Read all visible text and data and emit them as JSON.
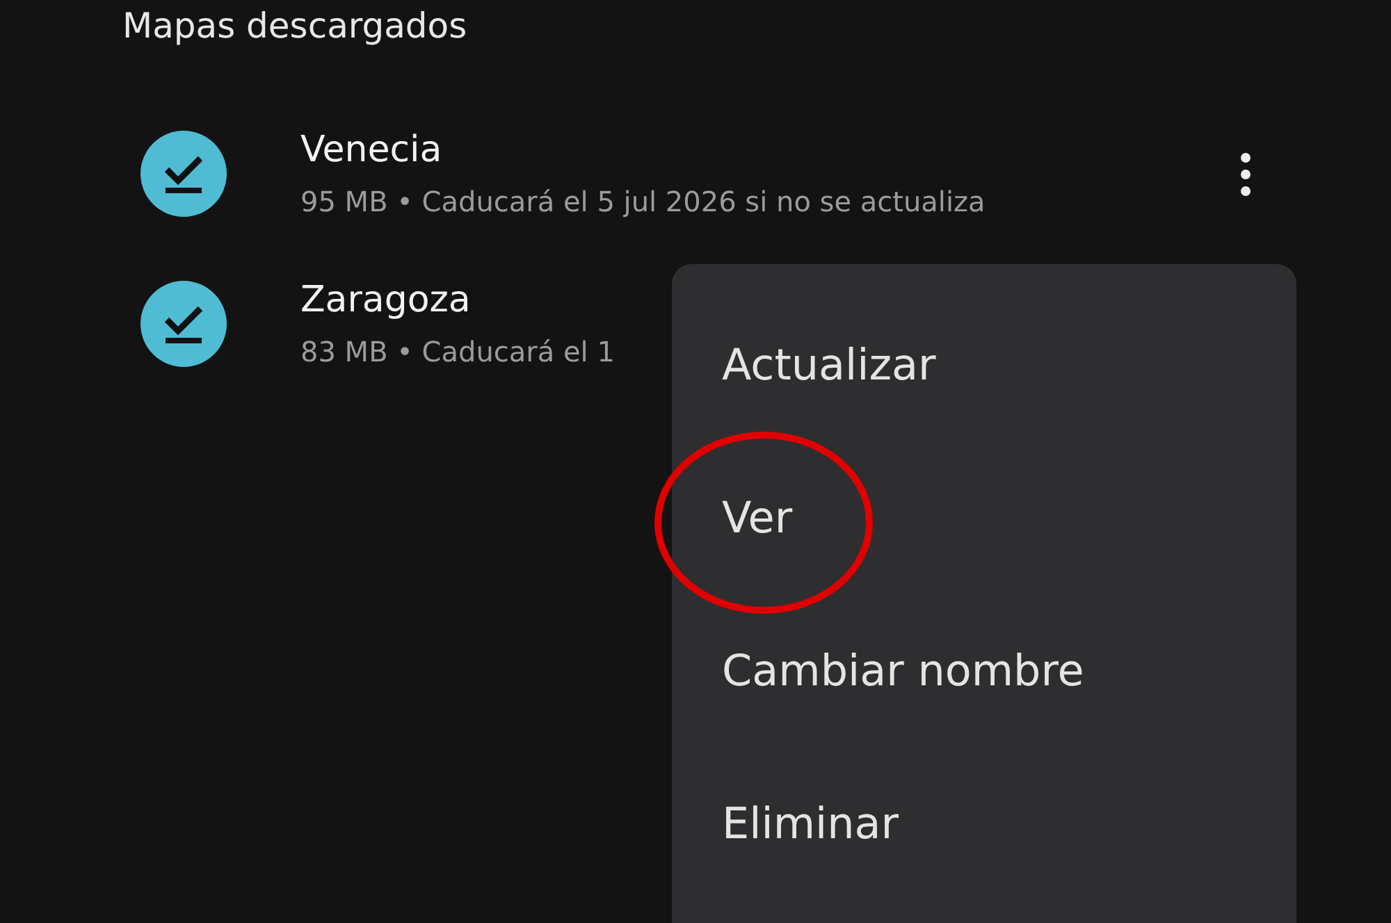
{
  "section_title": "Mapas descargados",
  "maps": [
    {
      "name": "Venecia",
      "details": "95 MB • Caducará el 5 jul 2026 si no se actualiza",
      "downloaded": true,
      "menu_button": true
    },
    {
      "name": "Zaragoza",
      "details": "83 MB • Caducará el 1",
      "downloaded": true,
      "menu_button": false
    }
  ],
  "menu": {
    "items": [
      {
        "label": "Actualizar",
        "highlighted": false
      },
      {
        "label": "Ver",
        "highlighted": true
      },
      {
        "label": "Cambiar nombre",
        "highlighted": false
      },
      {
        "label": "Eliminar",
        "highlighted": false
      }
    ]
  }
}
